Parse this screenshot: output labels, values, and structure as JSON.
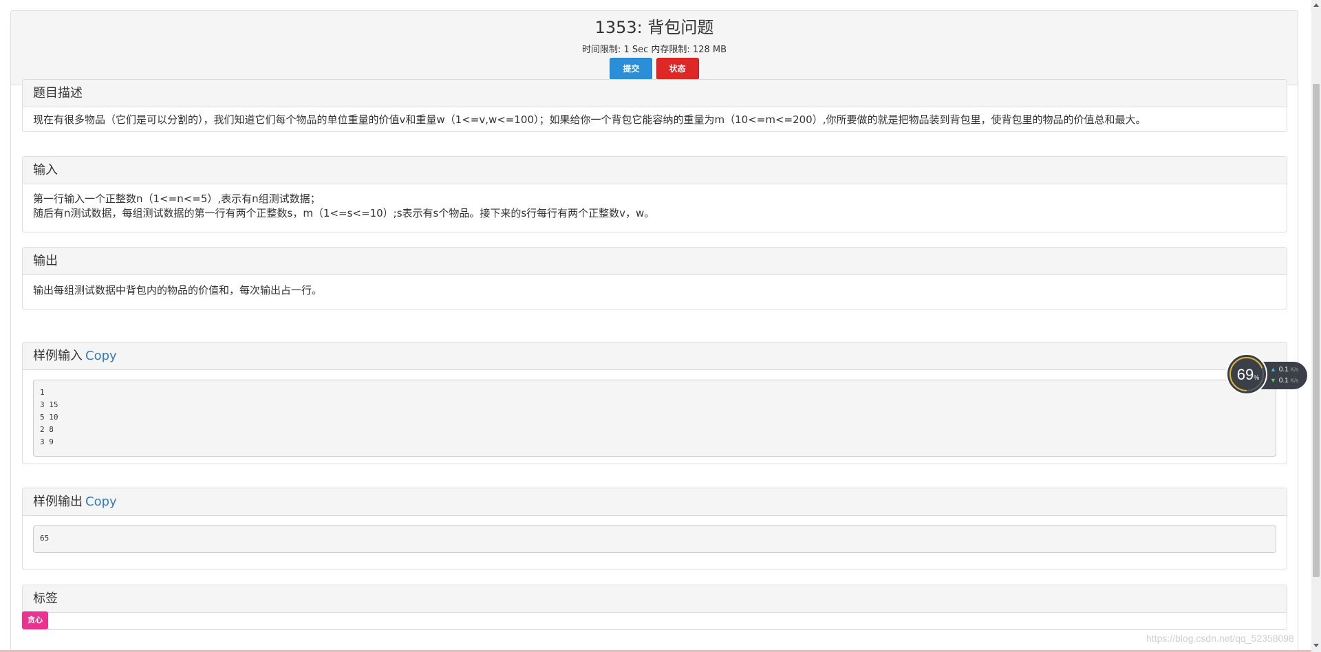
{
  "problem": {
    "title": "1353: 背包问题",
    "limits": "时间限制: 1 Sec  内存限制: 128 MB",
    "submit_label": "提交",
    "status_label": "状态"
  },
  "sections": {
    "description": {
      "heading": "题目描述",
      "text": "现在有很多物品（它们是可以分割的），我们知道它们每个物品的单位重量的价值v和重量w（1<=v,w<=100）；如果给你一个背包它能容纳的重量为m（10<=m<=200）,你所要做的就是把物品装到背包里，使背包里的物品的价值总和最大。"
    },
    "input": {
      "heading": "输入",
      "lines": [
        "第一行输入一个正整数n（1<=n<=5）,表示有n组测试数据；",
        "随后有n测试数据，每组测试数据的第一行有两个正整数s，m（1<=s<=10）;s表示有s个物品。接下来的s行每行有两个正整数v，w。"
      ]
    },
    "output": {
      "heading": "输出",
      "text": "输出每组测试数据中背包内的物品的价值和，每次输出占一行。"
    },
    "sample_input": {
      "heading": "样例输入",
      "copy_label": "Copy",
      "lines": [
        "1",
        "3 15",
        "5 10",
        "2 8",
        "3 9"
      ]
    },
    "sample_output": {
      "heading": "样例输出",
      "copy_label": "Copy",
      "lines": [
        "65"
      ]
    },
    "tags": {
      "heading": "标签",
      "items": [
        "贪心"
      ]
    }
  },
  "net_widget": {
    "percent": "69",
    "percent_unit": "%",
    "upload": "0.1",
    "download": "0.1",
    "unit": "K/s",
    "percent_value": 69
  },
  "watermark": "https://blog.csdn.net/qq_52358098",
  "colors": {
    "primary": "#2a8fd8",
    "danger": "#de2828",
    "tag": "#e8338f",
    "link": "#337ab7"
  }
}
